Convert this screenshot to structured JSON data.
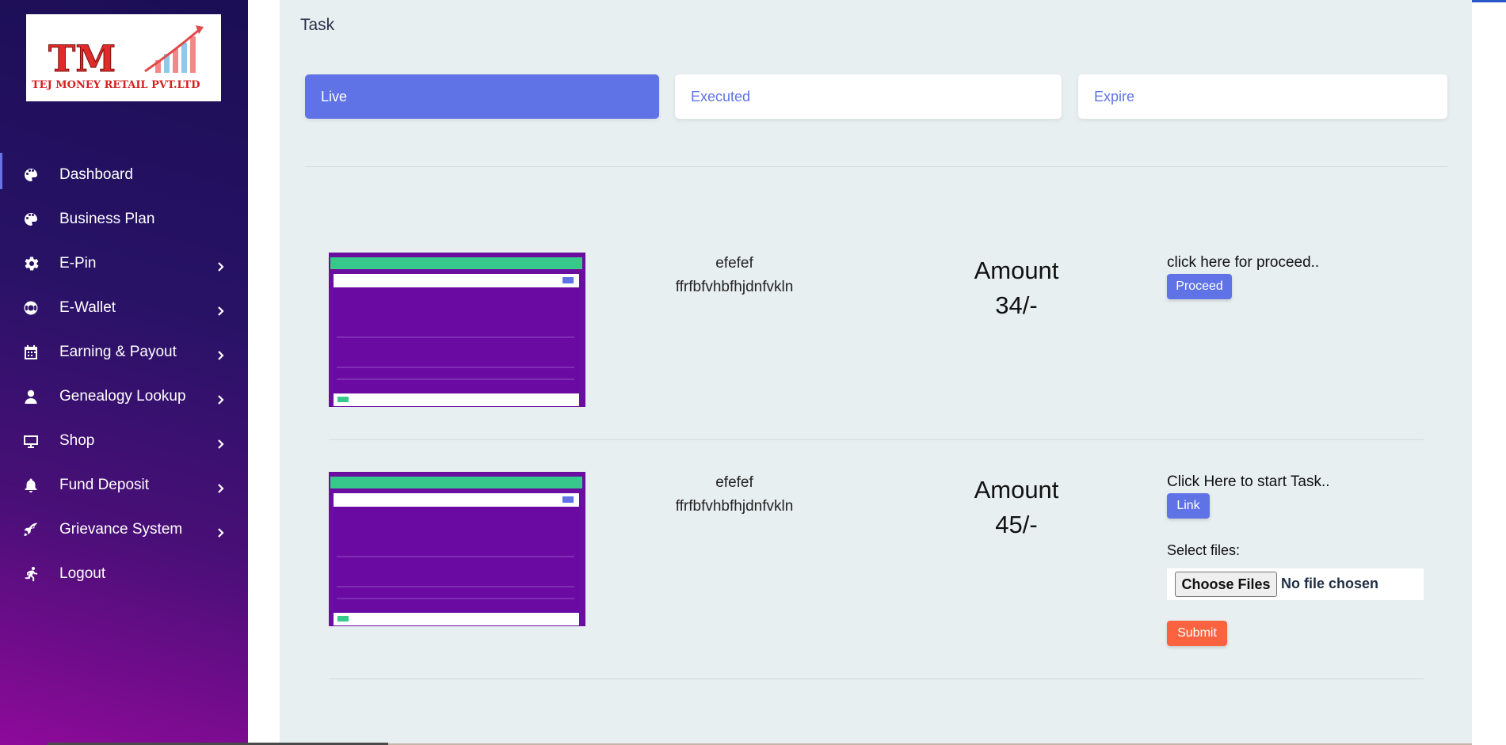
{
  "brand": {
    "logo_letters": "TM",
    "company_name": "TEJ MONEY RETAIL PVT.LTD"
  },
  "sidebar": {
    "items": [
      {
        "label": "Dashboard",
        "icon": "palette-icon",
        "has_submenu": false,
        "active": true
      },
      {
        "label": "Business Plan",
        "icon": "palette-icon",
        "has_submenu": false
      },
      {
        "label": "E-Pin",
        "icon": "gear-icon",
        "has_submenu": true
      },
      {
        "label": "E-Wallet",
        "icon": "lifebuoy-icon",
        "has_submenu": true
      },
      {
        "label": "Earning & Payout",
        "icon": "calendar-icon",
        "has_submenu": true
      },
      {
        "label": "Genealogy Lookup",
        "icon": "user-icon",
        "has_submenu": true
      },
      {
        "label": "Shop",
        "icon": "monitor-icon",
        "has_submenu": true
      },
      {
        "label": "Fund Deposit",
        "icon": "bell-icon",
        "has_submenu": true
      },
      {
        "label": "Grievance System",
        "icon": "rocket-icon",
        "has_submenu": true
      },
      {
        "label": "Logout",
        "icon": "running-icon",
        "has_submenu": false
      }
    ]
  },
  "page": {
    "title": "Task",
    "tabs": [
      {
        "label": "Live",
        "active": true
      },
      {
        "label": "Executed"
      },
      {
        "label": "Expire"
      }
    ]
  },
  "tasks": [
    {
      "name": "efefef",
      "description": "ffrfbfvhbfhjdnfvkln",
      "amount_label": "Amount",
      "amount_value": "34/-",
      "cta_text": "click here for proceed..",
      "button_label": "Proceed"
    },
    {
      "name": "efefef",
      "description": "ffrfbfvhbfhjdnfvkln",
      "amount_label": "Amount",
      "amount_value": "45/-",
      "cta_text": "Click Here to start Task..",
      "button_label": "Link",
      "select_files_label": "Select files:",
      "choose_files_label": "Choose Files",
      "file_status": "No file chosen",
      "submit_label": "Submit"
    }
  ],
  "colors": {
    "accent": "#5f73e6",
    "submit": "#fb6340",
    "panel": "#e8eff0",
    "sidebar_top": "#1b0e55",
    "sidebar_bottom": "#8e0a9a"
  }
}
